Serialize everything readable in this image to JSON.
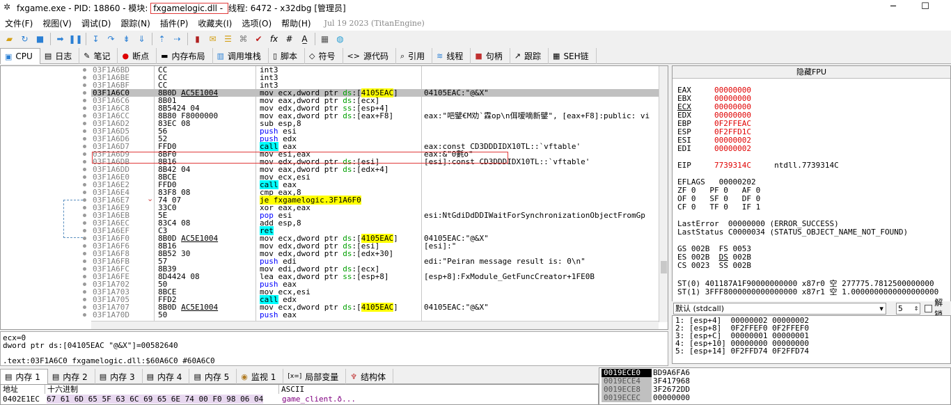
{
  "title": {
    "prefix": "fxgame.exe - PID: 18860 - 模块: ",
    "module": "fxgamelogic.dll - ",
    "suffix": "线程: 6472 - x32dbg [管理员]"
  },
  "window_buttons": {
    "minimize": "─",
    "maximize": "☐",
    "close": "✕"
  },
  "menu": {
    "items": [
      "文件(F)",
      "视图(V)",
      "调试(D)",
      "跟踪(N)",
      "插件(P)",
      "收藏夹(I)",
      "选项(O)",
      "帮助(H)"
    ],
    "date": "Jul 19 2023 (TitanEngine)"
  },
  "tabs": [
    {
      "icon": "▣",
      "label": "CPU"
    },
    {
      "icon": "▤",
      "label": "日志"
    },
    {
      "icon": "✎",
      "label": "笔记"
    },
    {
      "icon": "●",
      "label": "断点"
    },
    {
      "icon": "▬",
      "label": "内存布局"
    },
    {
      "icon": "▥",
      "label": "调用堆栈"
    },
    {
      "icon": "▯",
      "label": "脚本"
    },
    {
      "icon": "◇",
      "label": "符号"
    },
    {
      "icon": "<>",
      "label": "源代码"
    },
    {
      "icon": "⌕",
      "label": "引用"
    },
    {
      "icon": "≋",
      "label": "线程"
    },
    {
      "icon": "■",
      "label": "句柄"
    },
    {
      "icon": "↗",
      "label": "跟踪"
    },
    {
      "icon": "▦",
      "label": "SEH链"
    }
  ],
  "disasm": [
    {
      "addr": "03F1A6BD",
      "bytes": "CC",
      "ins": "int3",
      "cmt": ""
    },
    {
      "addr": "03F1A6BE",
      "bytes": "CC",
      "ins": "int3",
      "cmt": ""
    },
    {
      "addr": "03F1A6BF",
      "bytes": "CC",
      "ins": "int3",
      "cmt": ""
    },
    {
      "addr": "03F1A6C0",
      "bytes": "8B0D AC5E1004",
      "ins": "mov ecx,dword ptr ds:[4105EAC]",
      "cmt": "04105EAC:\"@&X\"",
      "cur": true
    },
    {
      "addr": "03F1A6C6",
      "bytes": "8B01",
      "ins": "mov eax,dword ptr ds:[ecx]",
      "cmt": ""
    },
    {
      "addr": "03F1A6C8",
      "bytes": "8B5424 04",
      "ins": "mov edx,dword ptr ss:[esp+4]",
      "cmt": ""
    },
    {
      "addr": "03F1A6CC",
      "bytes": "8B80 F8000000",
      "ins": "mov eax,dword ptr ds:[eax+F8]",
      "cmt": "eax:\"吧鐾€M劝`霖op\\n佴嗳嘀新鐾\", [eax+F8]:public: vi"
    },
    {
      "addr": "03F1A6D2",
      "bytes": "83EC 08",
      "ins": "sub esp,8",
      "cmt": ""
    },
    {
      "addr": "03F1A6D5",
      "bytes": "56",
      "ins": "push esi",
      "cmt": ""
    },
    {
      "addr": "03F1A6D6",
      "bytes": "52",
      "ins": "push edx",
      "cmt": ""
    },
    {
      "addr": "03F1A6D7",
      "bytes": "FFD0",
      "ins": "call eax",
      "cmt": "eax:const CD3DDDIDX10TL::`vftable'"
    },
    {
      "addr": "03F1A6D9",
      "bytes": "8BF0",
      "ins": "mov esi,eax",
      "cmt": "eax:&\"0氀o\""
    },
    {
      "addr": "03F1A6DB",
      "bytes": "8B16",
      "ins": "mov edx,dword ptr ds:[esi]",
      "cmt": "[esi]:const CD3DDDIDX10TL::`vftable'"
    },
    {
      "addr": "03F1A6DD",
      "bytes": "8B42 04",
      "ins": "mov eax,dword ptr ds:[edx+4]",
      "cmt": ""
    },
    {
      "addr": "03F1A6E0",
      "bytes": "8BCE",
      "ins": "mov ecx,esi",
      "cmt": ""
    },
    {
      "addr": "03F1A6E2",
      "bytes": "FFD0",
      "ins": "call eax",
      "cmt": ""
    },
    {
      "addr": "03F1A6E4",
      "bytes": "83F8 08",
      "ins": "cmp eax,8",
      "cmt": ""
    },
    {
      "addr": "03F1A6E7",
      "bytes": "74 07",
      "ins": "je fxgamelogic.3F1A6F0",
      "cmt": "",
      "arrow": "v"
    },
    {
      "addr": "03F1A6E9",
      "bytes": "33C0",
      "ins": "xor eax,eax",
      "cmt": ""
    },
    {
      "addr": "03F1A6EB",
      "bytes": "5E",
      "ins": "pop esi",
      "cmt": "esi:NtGdiDdDDIWaitForSynchronizationObjectFromGp"
    },
    {
      "addr": "03F1A6EC",
      "bytes": "83C4 08",
      "ins": "add esp,8",
      "cmt": ""
    },
    {
      "addr": "03F1A6EF",
      "bytes": "C3",
      "ins": "ret",
      "cmt": ""
    },
    {
      "addr": "03F1A6F0",
      "bytes": "8B0D AC5E1004",
      "ins": "mov ecx,dword ptr ds:[4105EAC]",
      "cmt": "04105EAC:\"@&X\""
    },
    {
      "addr": "03F1A6F6",
      "bytes": "8B16",
      "ins": "mov edx,dword ptr ds:[esi]",
      "cmt": "[esi]:\""
    },
    {
      "addr": "03F1A6F8",
      "bytes": "8B52 30",
      "ins": "mov edx,dword ptr ds:[edx+30]",
      "cmt": ""
    },
    {
      "addr": "03F1A6FB",
      "bytes": "57",
      "ins": "push edi",
      "cmt": "edi:\"Peiran message result is: 0\\n\""
    },
    {
      "addr": "03F1A6FC",
      "bytes": "8B39",
      "ins": "mov edi,dword ptr ds:[ecx]",
      "cmt": ""
    },
    {
      "addr": "03F1A6FE",
      "bytes": "8D4424 08",
      "ins": "lea eax,dword ptr ss:[esp+8]",
      "cmt": "[esp+8]:FxModule_GetFuncCreator+1FE0B"
    },
    {
      "addr": "03F1A702",
      "bytes": "50",
      "ins": "push eax",
      "cmt": ""
    },
    {
      "addr": "03F1A703",
      "bytes": "8BCE",
      "ins": "mov ecx,esi",
      "cmt": ""
    },
    {
      "addr": "03F1A705",
      "bytes": "FFD2",
      "ins": "call edx",
      "cmt": ""
    },
    {
      "addr": "03F1A707",
      "bytes": "8B0D AC5E1004",
      "ins": "mov ecx,dword ptr ds:[4105EAC]",
      "cmt": "04105EAC:\"@&X\""
    },
    {
      "addr": "03F1A70D",
      "bytes": "50",
      "ins": "push eax",
      "cmt": ""
    }
  ],
  "info": {
    "line1": "ecx=0",
    "line2": "dword ptr ds:[04105EAC \"@&X\"]=00582640",
    "line3": ".text:03F1A6C0 fxgamelogic.dll:$60A6C0 #60A6C0"
  },
  "registers": {
    "header": "隐藏FPU",
    "gpr": [
      [
        "EAX",
        "00000000"
      ],
      [
        "EBX",
        "00000000"
      ],
      [
        "ECX",
        "00000000"
      ],
      [
        "EDX",
        "00000000"
      ],
      [
        "EBP",
        "0F2FFEAC"
      ],
      [
        "ESP",
        "0F2FFD1C"
      ],
      [
        "ESI",
        "00000002"
      ],
      [
        "EDI",
        "00000002"
      ]
    ],
    "eip": [
      "EIP",
      "7739314C",
      "ntdll.7739314C"
    ],
    "eflags": "EFLAGS   00000202",
    "flags": [
      "ZF 0   PF 0   AF 0",
      "OF 0   SF 0   DF 0",
      "CF 0   TF 0   IF 1"
    ],
    "lasterror": "LastError  00000000 (ERROR_SUCCESS)",
    "laststatus": "LastStatus C0000034 (STATUS_OBJECT_NAME_NOT_FOUND)",
    "segs": [
      "GS 002B  FS 0053",
      "ES 002B  DS 002B",
      "CS 0023  SS 002B"
    ],
    "st0": "ST(0) 401187A1F90000000000 x87r0 空 277775.7812500000000",
    "st1": "ST(1) 3FFF8000000000000000 x87r1 空 1.0000000000000000000"
  },
  "callconv": {
    "label": "默认 (stdcall)",
    "count": "5",
    "unlock": "解锁"
  },
  "stackargs": [
    "1: [esp+4]  00000002 00000002",
    "2: [esp+8]  0F2FFEF0 0F2FFEF0",
    "3: [esp+C]  00000001 00000001",
    "4: [esp+10] 00000000 00000000",
    "5: [esp+14] 0F2FFD74 0F2FFD74"
  ],
  "bottom_tabs": [
    {
      "icon": "▤",
      "label": "内存 1"
    },
    {
      "icon": "▤",
      "label": "内存 2"
    },
    {
      "icon": "▤",
      "label": "内存 3"
    },
    {
      "icon": "▤",
      "label": "内存 4"
    },
    {
      "icon": "▤",
      "label": "内存 5"
    },
    {
      "icon": "◉",
      "label": "监视 1"
    },
    {
      "icon": "[x=]",
      "label": "局部变量"
    },
    {
      "icon": "♆",
      "label": "结构体"
    }
  ],
  "dump": {
    "headers": [
      "地址",
      "十六进制",
      "ASCII"
    ],
    "addr": "0402E1EC",
    "hex": "67 61 6D 65 5F 63 6C 69 65 6E 74 00 F0 98 06 04",
    "ascii": "game_client.ð..."
  },
  "stack": [
    {
      "addr": "0019ECE0",
      "val": "BD9A6FA6"
    },
    {
      "addr": "0019ECE4",
      "val": "3F417968"
    },
    {
      "addr": "0019ECE8",
      "val": "3F2672DD"
    },
    {
      "addr": "0019ECEC",
      "val": "00000000"
    }
  ],
  "colors": {
    "accent_red": "#e03a3a",
    "value_red": "#e00000",
    "call_bg": "#00ffff",
    "mem_bg": "#ffff00"
  }
}
